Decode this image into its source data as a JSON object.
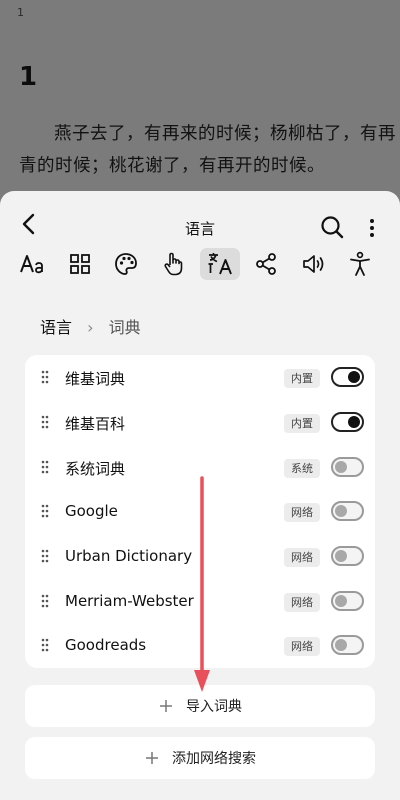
{
  "reader": {
    "page_number": "1",
    "chapter_title": "1",
    "paragraph": "燕子去了，有再来的时候；杨柳枯了，有再青的时候；桃花谢了，有再开的时候。"
  },
  "panel": {
    "title": "语言",
    "breadcrumb": {
      "parent": "语言",
      "separator": "›",
      "current": "词典"
    },
    "toolbar_icons": [
      "font-icon",
      "grid-icon",
      "palette-icon",
      "touch-icon",
      "translate-icon",
      "share-icon",
      "speaker-icon",
      "accessibility-icon"
    ],
    "active_tool": "translate-icon"
  },
  "dictionaries": [
    {
      "name": "维基词典",
      "badge": "内置",
      "enabled": true
    },
    {
      "name": "维基百科",
      "badge": "内置",
      "enabled": true
    },
    {
      "name": "系统词典",
      "badge": "系统",
      "enabled": false
    },
    {
      "name": "Google",
      "badge": "网络",
      "enabled": false
    },
    {
      "name": "Urban Dictionary",
      "badge": "网络",
      "enabled": false
    },
    {
      "name": "Merriam-Webster",
      "badge": "网络",
      "enabled": false
    },
    {
      "name": "Goodreads",
      "badge": "网络",
      "enabled": false
    }
  ],
  "actions": {
    "import_label": "导入词典",
    "add_web_search_label": "添加网络搜索"
  },
  "colors": {
    "annotation_arrow": "#e8505b"
  }
}
